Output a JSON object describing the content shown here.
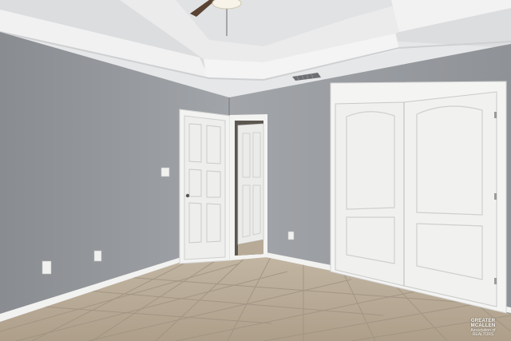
{
  "photo": {
    "subject": "empty bedroom",
    "colors": {
      "wall": "#94979b",
      "ceiling": "#e8e9ea",
      "trim": "#f4f4f3",
      "door": "#f2f2f1",
      "floor_tile": "#b9ac99",
      "grout": "#9f9281"
    }
  },
  "watermark": {
    "line1": "GREATER MCALLEN",
    "line2": "Association of REALTORS"
  }
}
